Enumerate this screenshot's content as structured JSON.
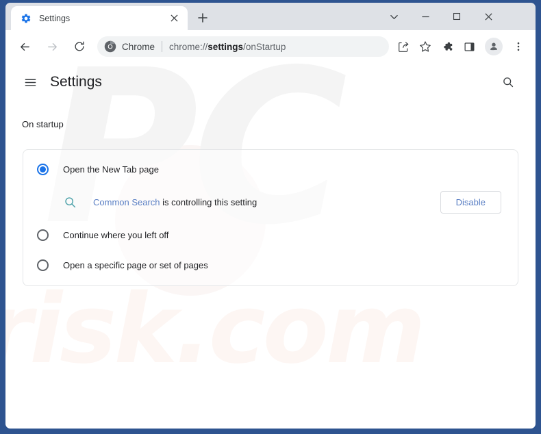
{
  "window": {
    "frame_color": "#2e5490",
    "controls": {
      "tab_search": "tab-search-chevron",
      "minimize": "minimize",
      "maximize": "maximize",
      "close": "close"
    }
  },
  "tabstrip": {
    "tabs": [
      {
        "title": "Settings",
        "favicon": "settings-gear-icon",
        "active": true
      }
    ],
    "new_tab_label": "+"
  },
  "toolbar": {
    "back_icon": "back-arrow-icon",
    "forward_icon": "forward-arrow-icon",
    "reload_icon": "reload-icon",
    "omnibox": {
      "site_icon": "chrome-logo-icon",
      "scheme_label": "Chrome",
      "url_prefix": "chrome://",
      "url_bold": "settings",
      "url_suffix": "/onStartup",
      "full_url": "chrome://settings/onStartup"
    },
    "actions": [
      {
        "name": "share-icon"
      },
      {
        "name": "bookmark-star-icon"
      },
      {
        "name": "extensions-puzzle-icon"
      },
      {
        "name": "side-panel-icon"
      },
      {
        "name": "profile-avatar-icon"
      },
      {
        "name": "chrome-menu-icon"
      }
    ]
  },
  "settings_page": {
    "menu_icon": "hamburger-menu-icon",
    "title": "Settings",
    "search_icon": "search-icon",
    "section_label": "On startup",
    "options": [
      {
        "label": "Open the New Tab page",
        "selected": true
      },
      {
        "label": "Continue where you left off",
        "selected": false
      },
      {
        "label": "Open a specific page or set of pages",
        "selected": false
      }
    ],
    "controlled_banner": {
      "icon": "search-extension-icon",
      "icon_color": "#4aa0a8",
      "extension_name": "Common Search",
      "message": " is controlling this setting",
      "button_label": "Disable",
      "link_color": "#5a7fc4"
    }
  },
  "watermark": {
    "primary": "PC",
    "secondary": "risk.com"
  },
  "colors": {
    "accent_blue": "#1a73e8",
    "frame_blue": "#2e5490",
    "tabstrip_gray": "#dee1e6",
    "omnibox_gray": "#f1f3f4",
    "text_primary": "#202124",
    "text_secondary": "#5f6368"
  }
}
